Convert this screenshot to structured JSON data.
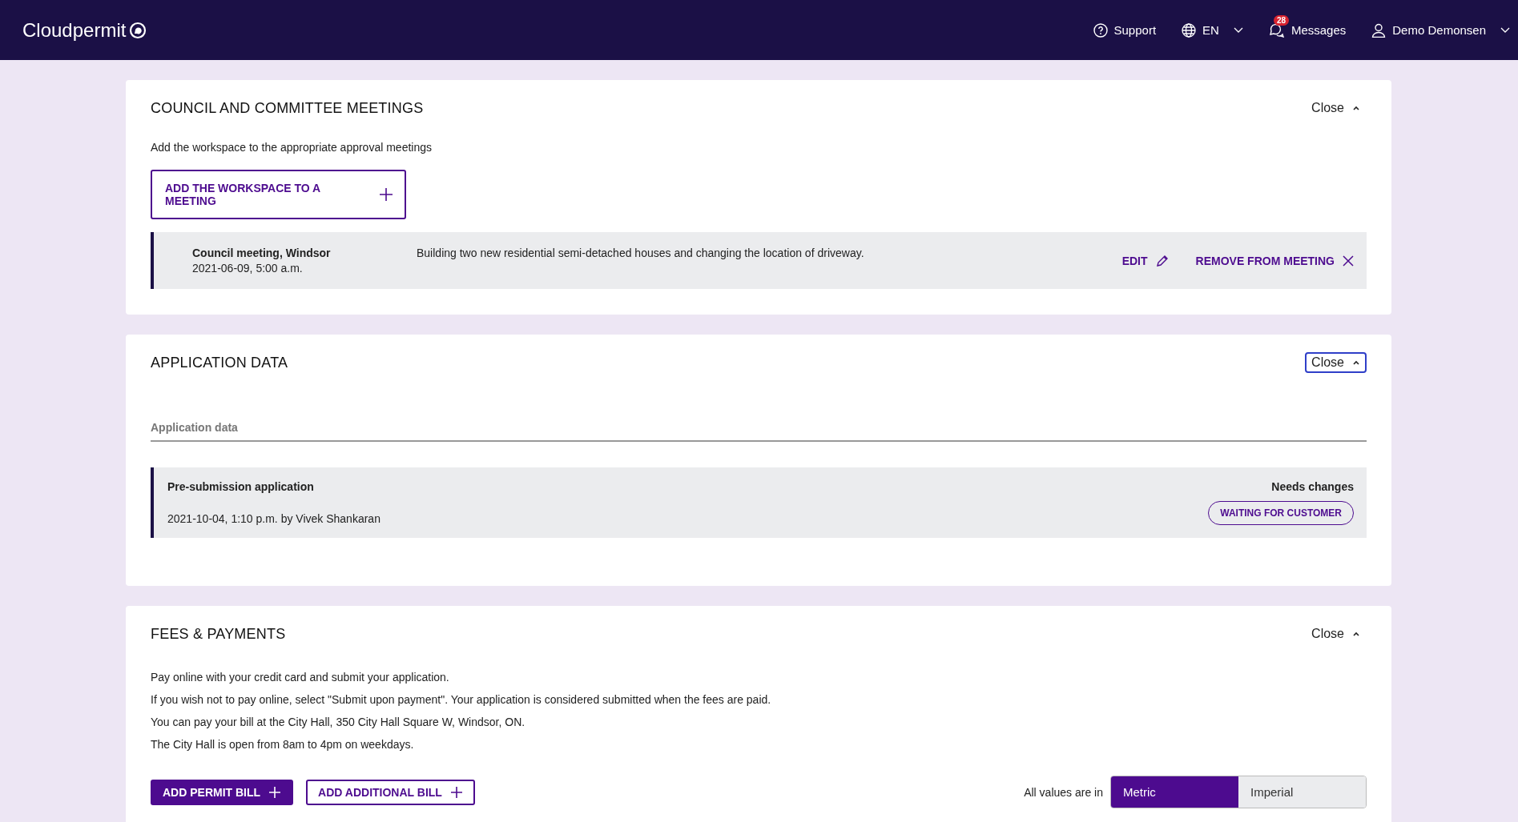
{
  "header": {
    "logo": "Cloudpermit",
    "support": "Support",
    "language": "EN",
    "messages": {
      "label": "Messages",
      "count": "28"
    },
    "user": "Demo Demonsen"
  },
  "meetings": {
    "title": "COUNCIL AND COMMITTEE MEETINGS",
    "close": {
      "label": "Close",
      "focused": false
    },
    "description": "Add the workspace to the appropriate approval meetings",
    "add_button": "ADD THE WORKSPACE TO A MEETING",
    "items": [
      {
        "name": "Council meeting, Windsor",
        "date": "2021-06-09, 5:00 a.m.",
        "description": "Building two new residential semi-detached houses and changing the location of driveway.",
        "edit": "EDIT",
        "remove": "REMOVE FROM MEETING"
      }
    ]
  },
  "application_data": {
    "title": "APPLICATION DATA",
    "close": {
      "label": "Close",
      "focused": true
    },
    "subheading": "Application data",
    "items": [
      {
        "name": "Pre-submission application",
        "meta": "2021-10-04, 1:10 p.m. by Vivek Shankaran",
        "status": "Needs changes",
        "badge": "WAITING FOR CUSTOMER"
      }
    ]
  },
  "fees": {
    "title": "FEES & PAYMENTS",
    "close": {
      "label": "Close",
      "focused": false
    },
    "paragraphs": [
      "Pay online with your credit card and submit your application.",
      "If you wish not to pay online, select \"Submit upon payment\". Your application is considered submitted when the fees are paid.",
      "You can pay your bill at the City Hall, 350 City Hall Square W, Windsor, ON.",
      "The City Hall is open from 8am to 4pm on weekdays."
    ],
    "buttons": [
      {
        "label": "ADD PERMIT BILL",
        "kind": "primary"
      },
      {
        "label": "ADD ADDITIONAL BILL",
        "kind": "outline"
      }
    ],
    "units_label": "All values are in",
    "units": [
      {
        "label": "Metric",
        "selected": true
      },
      {
        "label": "Imperial",
        "selected": false
      }
    ]
  }
}
